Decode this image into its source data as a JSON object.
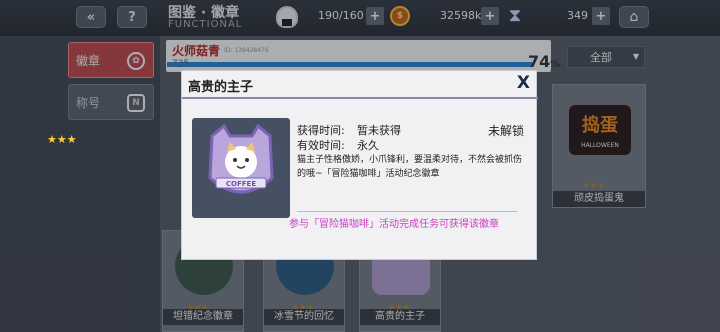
{
  "header": {
    "title": "图鉴 · 徽章",
    "subtitle": "FUNCTIONAL",
    "stamina": "190/160",
    "coins": "32598k",
    "coin_symbol": "$",
    "gems": "349",
    "back_label": "«",
    "help_label": "?",
    "plus": "+",
    "home_icon": "house-icon"
  },
  "sidebar": {
    "tabs": [
      {
        "label": "徽章",
        "icon": "badge-icon",
        "active": true
      },
      {
        "label": "称号",
        "icon": "title-icon",
        "active": false
      }
    ]
  },
  "profile": {
    "name": "火师菇青",
    "id": "ID: 139428476",
    "level": "735",
    "progress_label": "74",
    "progress_unit": "%",
    "progress_fraction": 0.74
  },
  "filter": {
    "label": "全部"
  },
  "grid": {
    "cards": [
      {
        "name": "顽皮捣蛋鬼",
        "stars": "★★★",
        "art": "HALLOWEEN",
        "art_title": "捣蛋"
      },
      {
        "name": "坦错纪念徽章",
        "stars": "★★★"
      },
      {
        "name": "冰雪节的回忆",
        "stars": "★★★"
      },
      {
        "name": "高贵的主子",
        "stars": "★★★"
      }
    ]
  },
  "modal": {
    "title": "高贵的主子",
    "close": "X",
    "acquire_label": "获得时间:",
    "acquire_value": "暂未获得",
    "validity_label": "有效时间:",
    "validity_value": "永久",
    "status": "未解锁",
    "description": "猫主子性格傲娇，小爪锋利，要温柔对待，不然会被抓伤的哦~「冒险猫咖啡」活动纪念徽章",
    "hint": "参与「冒险猫咖啡」活动完成任务可获得该徽章",
    "badge_text": "COFFEE",
    "stars": "★★★"
  },
  "colors": {
    "accent": "#c64a4d",
    "hint": "#c83fc2",
    "title_bar": "#8189ad",
    "badge_purple": "#9b80c8"
  }
}
